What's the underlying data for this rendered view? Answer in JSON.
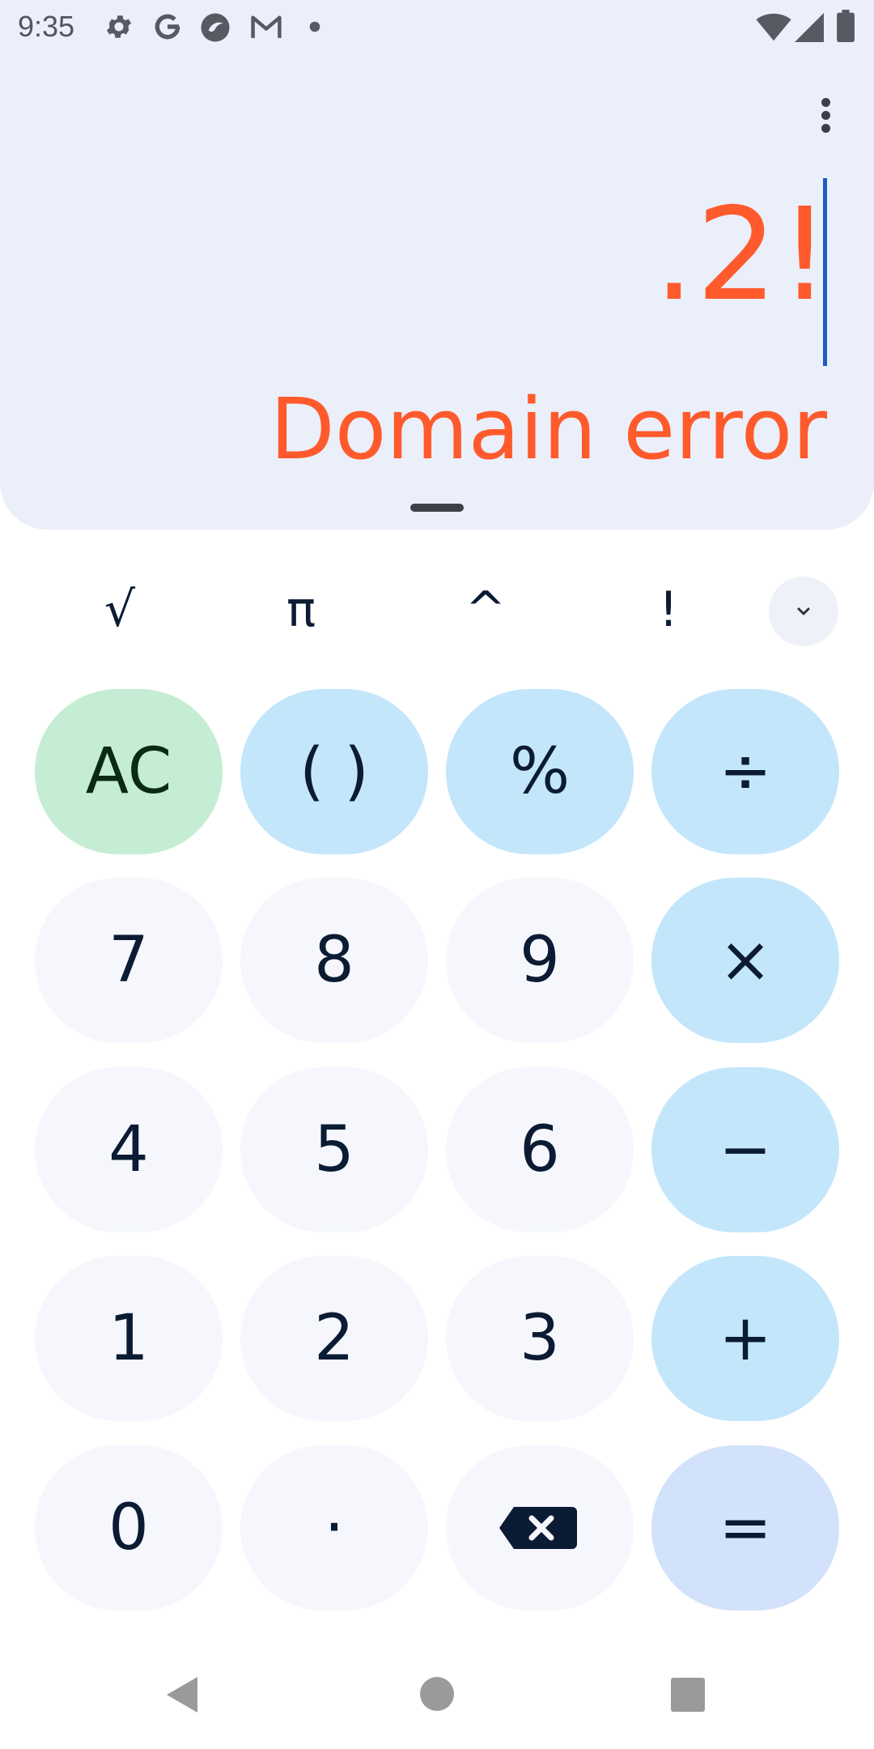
{
  "status_bar": {
    "time": "9:35",
    "left_icons": [
      "gear-icon",
      "google-icon",
      "photo-app-icon",
      "gmail-icon",
      "dot-icon"
    ],
    "right_icons": [
      "wifi-icon",
      "signal-icon",
      "battery-icon"
    ]
  },
  "display": {
    "expression": ".2!",
    "result": "Domain error",
    "accent_color": "#fe5a2c"
  },
  "scientific_row": {
    "keys": [
      "√",
      "π",
      "^",
      "!"
    ],
    "expand_icon": "chevron-down-icon"
  },
  "keypad": {
    "rows": [
      [
        "AC",
        "( )",
        "%",
        "÷"
      ],
      [
        "7",
        "8",
        "9",
        "×"
      ],
      [
        "4",
        "5",
        "6",
        "−"
      ],
      [
        "1",
        "2",
        "3",
        "+"
      ],
      [
        "0",
        "·",
        "backspace-icon",
        "="
      ]
    ]
  },
  "nav_bar": {
    "icons": [
      "back-icon",
      "home-icon",
      "recents-icon"
    ]
  }
}
